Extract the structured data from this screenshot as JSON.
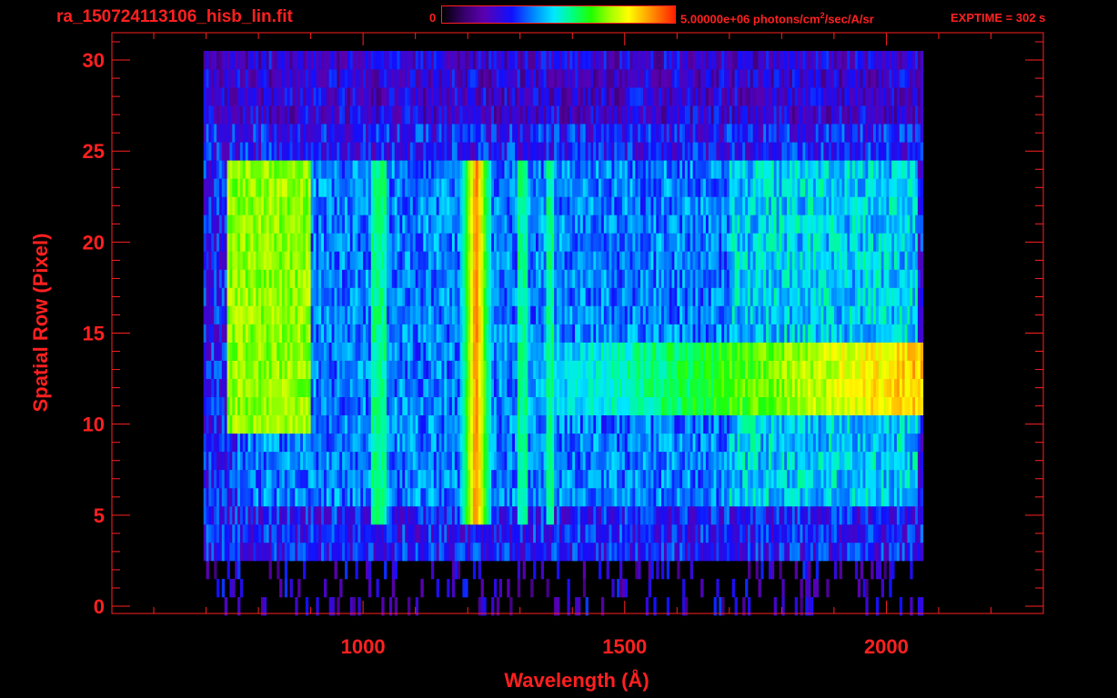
{
  "header": {
    "file_title": "ra_150724113106_hisb_lin.fit",
    "colorbar_min": "0",
    "colorbar_max_prefix": "5.00000e+06 photons/cm",
    "colorbar_max_exp": "2",
    "colorbar_max_suffix": "/sec/A/sr",
    "exptime": "EXPTIME = 302 s"
  },
  "colors": {
    "axis": "#ff2020",
    "background": "#000000"
  },
  "chart_data": {
    "type": "heatmap",
    "title": "ra_150724113106_hisb_lin.fit",
    "xlabel": "Wavelength (Å)",
    "ylabel": "Spatial Row (Pixel)",
    "xlim": [
      520,
      2300
    ],
    "ylim": [
      -0.4,
      31.5
    ],
    "x_ticks": [
      1000,
      1500,
      2000
    ],
    "y_ticks": [
      0,
      5,
      10,
      15,
      20,
      25,
      30
    ],
    "x_tick_labels": [
      "1000",
      "1500",
      "2000"
    ],
    "y_tick_labels": [
      "0",
      "5",
      "10",
      "15",
      "20",
      "25",
      "30"
    ],
    "colorbar": {
      "min": 0,
      "max": 5000000,
      "units": "photons/cm^2/sec/A/sr"
    },
    "data_extent": {
      "x": [
        695,
        2070
      ],
      "rows": [
        0,
        30
      ]
    },
    "features": [
      {
        "name": "Lyman-alpha line",
        "center": 1216,
        "rows": [
          5,
          24
        ],
        "level": 0.9
      },
      {
        "name": "spatial band",
        "wavelength_range": [
          1300,
          2070
        ],
        "rows": [
          11,
          14
        ],
        "level": 0.8
      },
      {
        "name": "short-wavelength arc",
        "wavelength_range": [
          740,
          900
        ],
        "rows": [
          10,
          24
        ],
        "level": 0.75
      }
    ]
  }
}
